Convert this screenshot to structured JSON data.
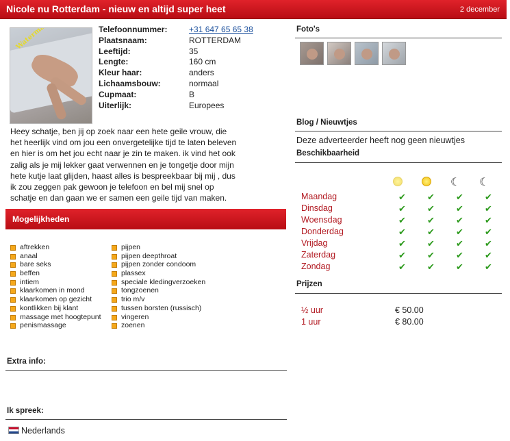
{
  "header": {
    "title": "Nicole nu Rotterdam - nieuw en altijd super heet",
    "date": "2 december"
  },
  "profile": {
    "fields": [
      {
        "label": "Telefoonnummer:",
        "value": "+31 647 65 65 38"
      },
      {
        "label": "Plaatsnaam:",
        "value": "ROTTERDAM"
      },
      {
        "label": "Leeftijd:",
        "value": "35"
      },
      {
        "label": "Lengte:",
        "value": "160 cm"
      },
      {
        "label": "Kleur haar:",
        "value": "anders"
      },
      {
        "label": "Lichaamsbouw:",
        "value": "normaal"
      },
      {
        "label": "Cupmaat:",
        "value": "B"
      },
      {
        "label": "Uiterlijk:",
        "value": "Europees"
      }
    ],
    "bio_lines": [
      "Heey schatje, ben jij op zoek naar een hete geile vrouw, die",
      "het heerlijk vind om jou een onvergetelijke tijd te laten beleven",
      "en hier is om het jou echt naar je zin te maken. ik vind het ook",
      "zalig als je mij lekker gaat verwennen en je tongetje door mijn",
      "hete kutje laat glijden, haast alles is bespreekbaar bij mij , dus",
      "ik zou zeggen pak gewoon je telefoon en bel mij snel op",
      "schatje en dan gaan we er samen een geile tijd van maken."
    ]
  },
  "mogelijkheden": {
    "title": "Mogelijkheden",
    "col1": [
      "aftrekken",
      "anaal",
      "bare seks",
      "beffen",
      "intiem",
      "klaarkomen in mond",
      "klaarkomen op gezicht",
      "kontlikken bij klant",
      "massage met hoogtepunt",
      "penismassage"
    ],
    "col2": [
      "pijpen",
      "pijpen deepthroat",
      "pijpen zonder condoom",
      "plassex",
      "speciale kledingverzoeken",
      "tongzoenen",
      "trio m/v",
      "tussen borsten (russisch)",
      "vingeren",
      "zoenen"
    ]
  },
  "extra_info": {
    "label": "Extra info:"
  },
  "languages": {
    "label": "Ik spreek:",
    "items": [
      "Nederlands"
    ]
  },
  "photos": {
    "label": "Foto's"
  },
  "blog": {
    "label": "Blog / Nieuwtjes",
    "text": "Deze adverteerder heeft nog geen nieuwtjes"
  },
  "availability": {
    "label": "Beschikbaarheid",
    "days": [
      "Maandag",
      "Dinsdag",
      "Woensdag",
      "Donderdag",
      "Vrijdag",
      "Zaterdag",
      "Zondag"
    ],
    "check_glyph": "✔",
    "slots": [
      "morning-sun-icon",
      "afternoon-sun-icon",
      "evening-moon-icon",
      "night-moon-icon"
    ]
  },
  "prices": {
    "label": "Prijzen",
    "items": [
      {
        "duration": "½  uur",
        "price": "€ 50.00"
      },
      {
        "duration": "1   uur",
        "price": "€ 80.00"
      }
    ]
  },
  "colors": {
    "brand_red": "#c8141c",
    "check_green": "#2c9a1c",
    "bullet_orange": "#f5a81a"
  }
}
